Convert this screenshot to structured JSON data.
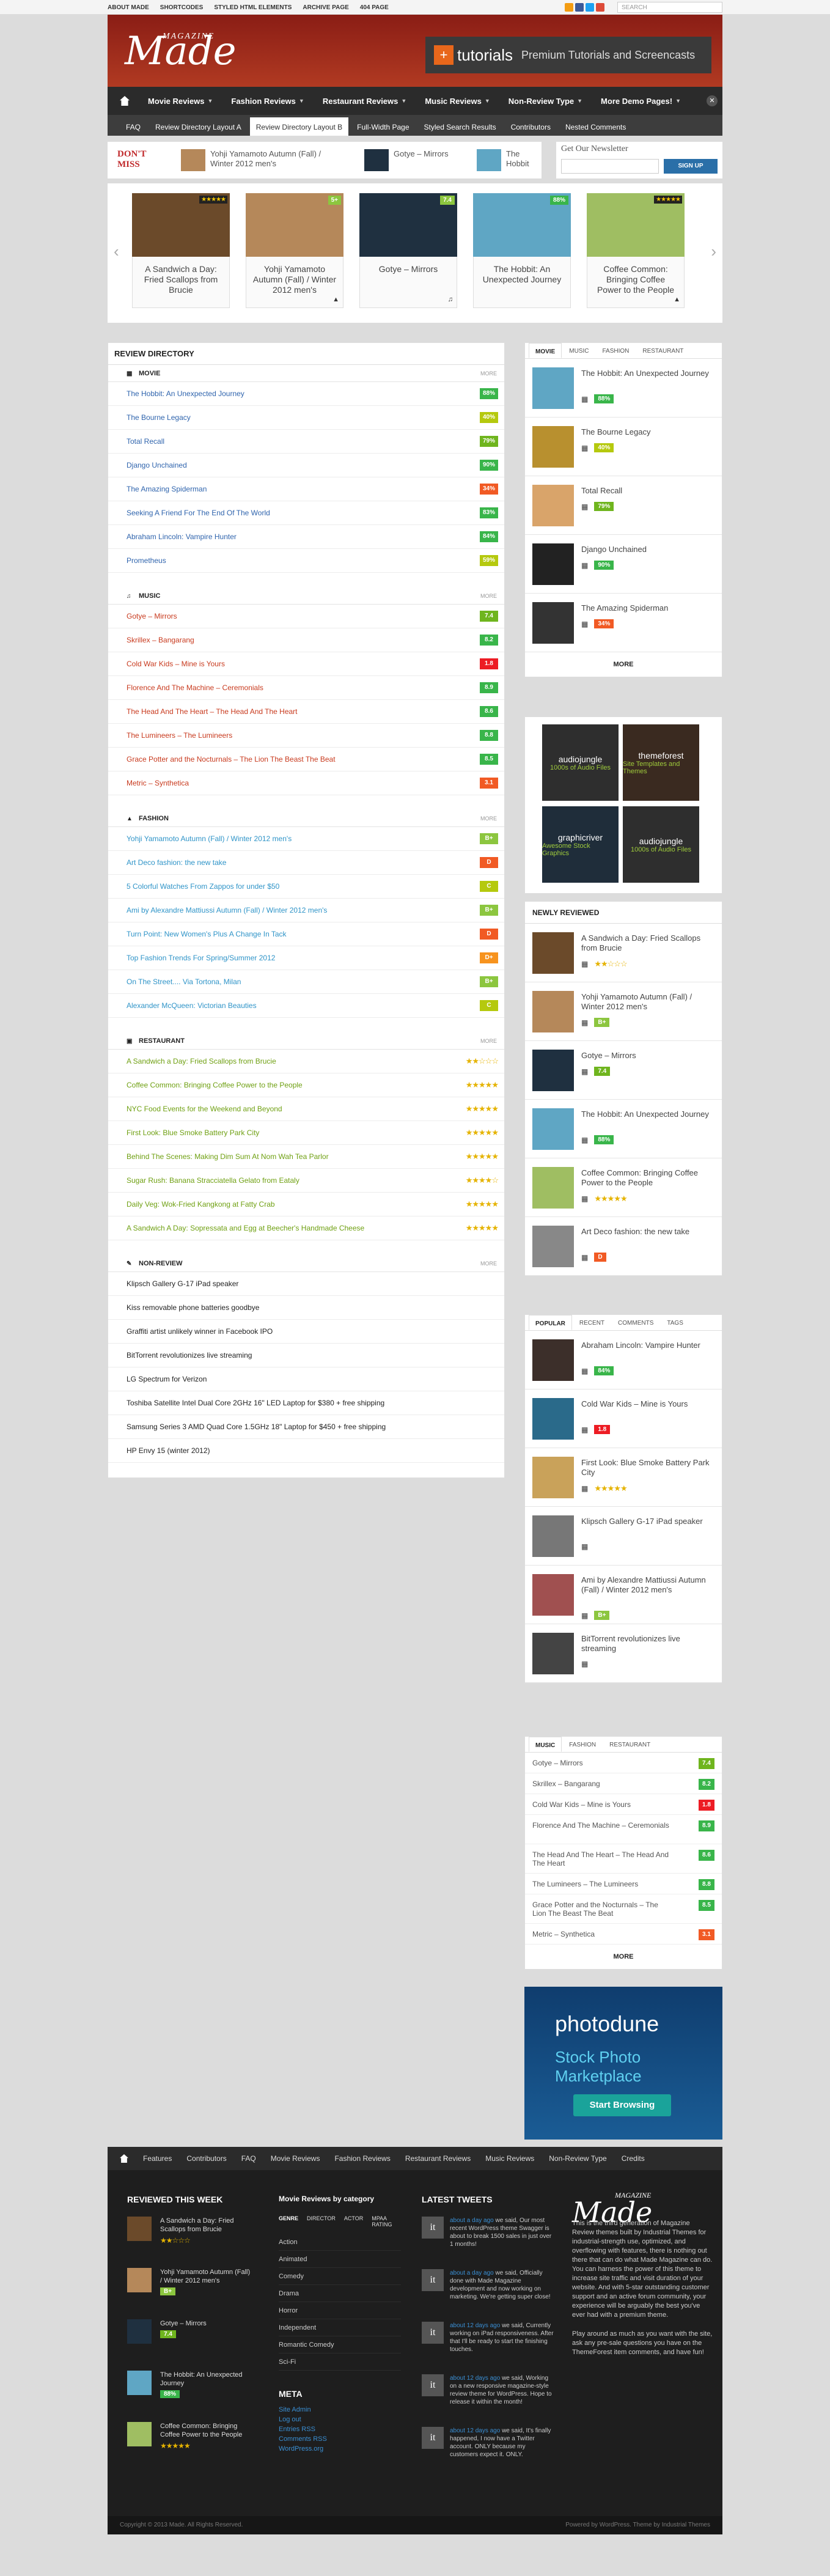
{
  "topnav": [
    "ABOUT MADE",
    "SHORTCODES",
    "STYLED HTML ELEMENTS",
    "ARCHIVE PAGE",
    "404 PAGE"
  ],
  "topsearch_placeholder": "SEARCH",
  "logo": {
    "small": "MAGAZINE",
    "big": "Made"
  },
  "banner": {
    "brand": "tutorials",
    "tagline": "Premium Tutorials and Screencasts"
  },
  "mainnav": [
    "Movie Reviews",
    "Fashion Reviews",
    "Restaurant Reviews",
    "Music Reviews",
    "Non-Review Type",
    "More Demo Pages!"
  ],
  "subnav": [
    "FAQ",
    "Review Directory Layout A",
    "Review Directory Layout B",
    "Full-Width Page",
    "Styled Search Results",
    "Contributors",
    "Nested Comments"
  ],
  "subnav_active": 2,
  "dontmiss": {
    "label": "DON'T MISS",
    "items": [
      "Yohji Yamamoto Autumn (Fall) / Winter 2012 men's",
      "Gotye – Mirrors",
      "The Hobbit"
    ]
  },
  "newsletter": {
    "title": "Get Our Newsletter",
    "button": "SIGN UP"
  },
  "carousel": [
    {
      "title": "A Sandwich a Day: Fried Scallops from Brucie",
      "stars": "★★★★★",
      "icon": "",
      "color": "#6b4a2a"
    },
    {
      "title": "Yohji Yamamoto Autumn (Fall) / Winter 2012 men's",
      "badge": "5+",
      "badge_color": "#8cc63f",
      "icon": "▲",
      "color": "#b5885a"
    },
    {
      "title": "Gotye – Mirrors",
      "badge": "7.4",
      "badge_color": "#8cc63f",
      "icon": "♫",
      "color": "#1f3040"
    },
    {
      "title": "The Hobbit: An Unexpected Journey",
      "badge": "88%",
      "badge_color": "#39b54a",
      "icon": "",
      "color": "#5fa6c4"
    },
    {
      "title": "Coffee Common: Bringing Coffee Power to the People",
      "stars": "★★★★★",
      "icon": "▲",
      "color": "#9fbe62"
    }
  ],
  "review_directory": {
    "title": "REVIEW DIRECTORY",
    "more": "MORE",
    "sections": [
      {
        "name": "MOVIE",
        "icon": "▦",
        "cls": "col-movie",
        "rows": [
          {
            "t": "The Hobbit: An Unexpected Journey",
            "s": "88%",
            "c": "#39b54a"
          },
          {
            "t": "The Bourne Legacy",
            "s": "40%",
            "c": "#b5c90e"
          },
          {
            "t": "Total Recall",
            "s": "79%",
            "c": "#6fb51e"
          },
          {
            "t": "Django Unchained",
            "s": "90%",
            "c": "#39b54a"
          },
          {
            "t": "The Amazing Spiderman",
            "s": "34%",
            "c": "#f15a24"
          },
          {
            "t": "Seeking A Friend For The End Of The World",
            "s": "83%",
            "c": "#39b54a"
          },
          {
            "t": "Abraham Lincoln: Vampire Hunter",
            "s": "84%",
            "c": "#39b54a"
          },
          {
            "t": "Prometheus",
            "s": "59%",
            "c": "#b5c90e"
          }
        ]
      },
      {
        "name": "MUSIC",
        "icon": "♫",
        "cls": "col-music",
        "rows": [
          {
            "t": "Gotye – Mirrors",
            "s": "7.4",
            "c": "#6fb51e"
          },
          {
            "t": "Skrillex – Bangarang",
            "s": "8.2",
            "c": "#39b54a"
          },
          {
            "t": "Cold War Kids – Mine is Yours",
            "s": "1.8",
            "c": "#ed1c24"
          },
          {
            "t": "Florence And The Machine – Ceremonials",
            "s": "8.9",
            "c": "#39b54a"
          },
          {
            "t": "The Head And The Heart – The Head And The Heart",
            "s": "8.6",
            "c": "#39b54a"
          },
          {
            "t": "The Lumineers – The Lumineers",
            "s": "8.8",
            "c": "#39b54a"
          },
          {
            "t": "Grace Potter and the Nocturnals – The Lion The Beast The Beat",
            "s": "8.5",
            "c": "#39b54a"
          },
          {
            "t": "Metric – Synthetica",
            "s": "3.1",
            "c": "#f15a24"
          }
        ]
      },
      {
        "name": "FASHION",
        "icon": "▲",
        "cls": "col-fashion",
        "rows": [
          {
            "t": "Yohji Yamamoto Autumn (Fall) / Winter 2012 men's",
            "s": "B+",
            "c": "#8cc63f"
          },
          {
            "t": "Art Deco fashion: the new take",
            "s": "D",
            "c": "#f15a24"
          },
          {
            "t": "5 Colorful Watches From Zappos for under $50",
            "s": "C",
            "c": "#b5c90e"
          },
          {
            "t": "Ami by Alexandre Mattiussi Autumn (Fall) / Winter 2012 men's",
            "s": "B+",
            "c": "#8cc63f"
          },
          {
            "t": "Turn Point: New Women's Plus A Change In Tack",
            "s": "D",
            "c": "#f15a24"
          },
          {
            "t": "Top Fashion Trends For Spring/Summer 2012",
            "s": "D+",
            "c": "#f7931e"
          },
          {
            "t": "On The Street.... Via Tortona, Milan",
            "s": "B+",
            "c": "#8cc63f"
          },
          {
            "t": "Alexander McQueen: Victorian Beauties",
            "s": "C",
            "c": "#b5c90e"
          }
        ]
      },
      {
        "name": "RESTAURANT",
        "icon": "▣",
        "cls": "col-rest",
        "rows": [
          {
            "t": "A Sandwich a Day: Fried Scallops from Brucie",
            "st": "★★☆☆☆"
          },
          {
            "t": "Coffee Common: Bringing Coffee Power to the People",
            "st": "★★★★★"
          },
          {
            "t": "NYC Food Events for the Weekend and Beyond",
            "st": "★★★★★"
          },
          {
            "t": "First Look: Blue Smoke Battery Park City",
            "st": "★★★★★"
          },
          {
            "t": "Behind The Scenes: Making Dim Sum At Nom Wah Tea Parlor",
            "st": "★★★★★"
          },
          {
            "t": "Sugar Rush: Banana Stracciatella Gelato from Eataly",
            "st": "★★★★☆"
          },
          {
            "t": "Daily Veg: Wok-Fried Kangkong at Fatty Crab",
            "st": "★★★★★"
          },
          {
            "t": "A Sandwich A Day: Sopressata and Egg at Beecher's Handmade Cheese",
            "st": "★★★★★"
          }
        ]
      },
      {
        "name": "NON-REVIEW",
        "icon": "✎",
        "cls": "col-non",
        "rows": [
          {
            "t": "Klipsch Gallery G-17 iPad speaker"
          },
          {
            "t": "Kiss removable phone batteries goodbye"
          },
          {
            "t": "Graffiti artist unlikely winner in Facebook IPO"
          },
          {
            "t": "BitTorrent revolutionizes live streaming"
          },
          {
            "t": "LG Spectrum for Verizon"
          },
          {
            "t": "Toshiba Satellite Intel Dual Core 2GHz 16\" LED Laptop for $380 + free shipping"
          },
          {
            "t": "Samsung Series 3 AMD Quad Core 1.5GHz 18\" Laptop for $450 + free shipping"
          },
          {
            "t": "HP Envy 15 (winter 2012)"
          }
        ]
      }
    ]
  },
  "sidebar_tabs1": {
    "tabs": [
      "MOVIE",
      "MUSIC",
      "FASHION",
      "RESTAURANT"
    ],
    "more": "MORE",
    "items": [
      {
        "t": "The Hobbit: An Unexpected Journey",
        "b": "88%",
        "c": "#39b54a",
        "col": "#5fa6c4"
      },
      {
        "t": "The Bourne Legacy",
        "b": "40%",
        "c": "#b5c90e",
        "col": "#b8902f"
      },
      {
        "t": "Total Recall",
        "b": "79%",
        "c": "#6fb51e",
        "col": "#d9a46a"
      },
      {
        "t": "Django Unchained",
        "b": "90%",
        "c": "#39b54a",
        "col": "#222"
      },
      {
        "t": "The Amazing Spiderman",
        "b": "34%",
        "c": "#f15a24",
        "col": "#333"
      }
    ]
  },
  "ads": [
    {
      "name": "audiojungle",
      "sub": "1000s of Audio Files"
    },
    {
      "name": "themeforest",
      "sub": "Site Templates and Themes"
    },
    {
      "name": "graphicriver",
      "sub": "Awesome Stock Graphics"
    },
    {
      "name": "audiojungle",
      "sub": "1000s of Audio Files"
    }
  ],
  "newly_reviewed": {
    "title": "NEWLY REVIEWED",
    "items": [
      {
        "t": "A Sandwich a Day: Fried Scallops from Brucie",
        "st": "★★☆☆☆",
        "col": "#6b4a2a"
      },
      {
        "t": "Yohji Yamamoto Autumn (Fall) / Winter 2012 men's",
        "b": "B+",
        "c": "#8cc63f",
        "col": "#b5885a"
      },
      {
        "t": "Gotye – Mirrors",
        "b": "7.4",
        "c": "#6fb51e",
        "col": "#1f3040"
      },
      {
        "t": "The Hobbit: An Unexpected Journey",
        "b": "88%",
        "c": "#39b54a",
        "col": "#5fa6c4"
      },
      {
        "t": "Coffee Common: Bringing Coffee Power to the People",
        "st": "★★★★★",
        "col": "#9fbe62"
      },
      {
        "t": "Art Deco fashion: the new take",
        "b": "D",
        "c": "#f15a24",
        "col": "#888"
      }
    ]
  },
  "popular": {
    "tabs": [
      "POPULAR",
      "RECENT",
      "COMMENTS",
      "TAGS"
    ],
    "items": [
      {
        "t": "Abraham Lincoln: Vampire Hunter",
        "b": "84%",
        "c": "#39b54a",
        "col": "#3c2f2a"
      },
      {
        "t": "Cold War Kids – Mine is Yours",
        "b": "1.8",
        "c": "#ed1c24",
        "col": "#2a6a8a"
      },
      {
        "t": "First Look: Blue Smoke Battery Park City",
        "st": "★★★★★",
        "col": "#c9a25a"
      },
      {
        "t": "Klipsch Gallery G-17 iPad speaker",
        "col": "#777"
      },
      {
        "t": "Ami by Alexandre Mattiussi Autumn (Fall) / Winter 2012 men's",
        "b": "B+",
        "c": "#8cc63f",
        "col": "#a05050"
      },
      {
        "t": "BitTorrent revolutionizes live streaming",
        "col": "#444"
      }
    ]
  },
  "music_list": {
    "tabs": [
      "MUSIC",
      "FASHION",
      "RESTAURANT"
    ],
    "more": "MORE",
    "rows": [
      {
        "t": "Gotye – Mirrors",
        "s": "7.4",
        "c": "#6fb51e"
      },
      {
        "t": "Skrillex – Bangarang",
        "s": "8.2",
        "c": "#39b54a"
      },
      {
        "t": "Cold War Kids – Mine is Yours",
        "s": "1.8",
        "c": "#ed1c24"
      },
      {
        "t": "Florence And The Machine – Ceremonials",
        "s": "8.9",
        "c": "#39b54a"
      },
      {
        "t": "The Head And The Heart – The Head And The Heart",
        "s": "8.6",
        "c": "#39b54a"
      },
      {
        "t": "The Lumineers – The Lumineers",
        "s": "8.8",
        "c": "#39b54a"
      },
      {
        "t": "Grace Potter and the Nocturnals – The Lion The Beast The Beat",
        "s": "8.5",
        "c": "#39b54a"
      },
      {
        "t": "Metric – Synthetica",
        "s": "3.1",
        "c": "#f15a24"
      }
    ]
  },
  "photodune": {
    "name": "photodune",
    "sub": "Stock Photo Marketplace",
    "btn": "Start Browsing"
  },
  "footnav": [
    "Features",
    "Contributors",
    "FAQ",
    "Movie Reviews",
    "Fashion Reviews",
    "Restaurant Reviews",
    "Music Reviews",
    "Non-Review Type",
    "Credits"
  ],
  "footer": {
    "reviewed_title": "REVIEWED THIS WEEK",
    "reviewed": [
      {
        "t": "A Sandwich a Day: Fried Scallops from Brucie",
        "st": "★★☆☆☆",
        "col": "#6b4a2a"
      },
      {
        "t": "Yohji Yamamoto Autumn (Fall) / Winter 2012 men's",
        "b": "B+",
        "c": "#8cc63f",
        "col": "#b5885a"
      },
      {
        "t": "Gotye – Mirrors",
        "b": "7.4",
        "c": "#6fb51e",
        "col": "#1f3040"
      },
      {
        "t": "The Hobbit: An Unexpected Journey",
        "b": "88%",
        "c": "#39b54a",
        "col": "#5fa6c4"
      },
      {
        "t": "Coffee Common: Bringing Coffee Power to the People",
        "st": "★★★★★",
        "col": "#9fbe62"
      }
    ],
    "cat_title": "Movie Reviews by category",
    "cat_tabs": [
      "GENRE",
      "DIRECTOR",
      "ACTOR",
      "MPAA RATING"
    ],
    "cats": [
      "Action",
      "Animated",
      "Comedy",
      "Drama",
      "Horror",
      "Independent",
      "Romantic Comedy",
      "Sci-Fi"
    ],
    "meta_title": "META",
    "meta": [
      "Site Admin",
      "Log out",
      "Entries RSS",
      "Comments RSS",
      "WordPress.org"
    ],
    "tweets_title": "LATEST TWEETS",
    "tweets": [
      {
        "tm": "about a day ago",
        "tx": "we said, Our most recent WordPress theme Swagger is about to break 1500 sales in just over 1 months!"
      },
      {
        "tm": "about a day ago",
        "tx": "we said, Officially done with Made Magazine development and now working on marketing. We're getting super close!"
      },
      {
        "tm": "about 12 days ago",
        "tx": "we said, Currently working on iPad responsiveness. After that I'll be ready to start the finishing touches."
      },
      {
        "tm": "about 12 days ago",
        "tx": "we said, Working on a new responsive magazine-style review theme for WordPress. Hope to release it within the month!"
      },
      {
        "tm": "about 12 days ago",
        "tx": "we said, It's finally happened, I now have a Twitter account. ONLY because my customers expect it. ONLY."
      }
    ],
    "about": "This is the third generation of Magazine Review themes built by Industrial Themes for industrial-strength use, optimized, and overflowing with features, there is nothing out there that can do what Made Magazine can do. You can harness the power of this theme to increase site traffic and visit duration of your website. And with 5-star outstanding customer support and an active forum community, your experience will be arguably the best you've ever had with a premium theme.",
    "about2": "Play around as much as you want with the site, ask any pre-sale questions you have on the ThemeForest item comments, and have fun!"
  },
  "copyright": {
    "left": "Copyright © 2013 Made. All Rights Reserved.",
    "right": "Powered by WordPress. Theme by Industrial Themes"
  }
}
